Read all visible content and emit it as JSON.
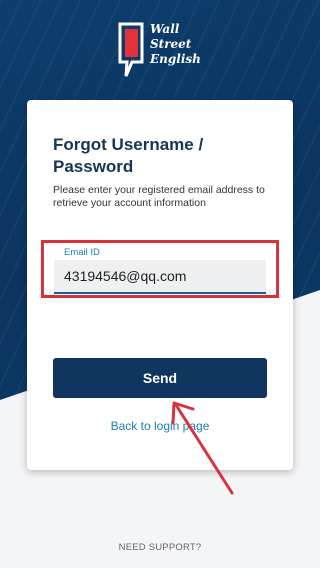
{
  "brand": {
    "logo_text_line1": "Wall",
    "logo_text_line2": "Street",
    "logo_text_line3": "English"
  },
  "card": {
    "title": "Forgot Username / Password",
    "description": "Please enter your registered email address to retrieve your account information",
    "email_label": "Email ID",
    "email_value": "43194546@qq.com",
    "send_label": "Send",
    "back_link_label": "Back to login page"
  },
  "footer": {
    "support_label": "NEED SUPPORT?"
  },
  "colors": {
    "brand_navy": "#10365f",
    "link_blue": "#1b7fb0",
    "highlight_red": "#d8323c"
  }
}
